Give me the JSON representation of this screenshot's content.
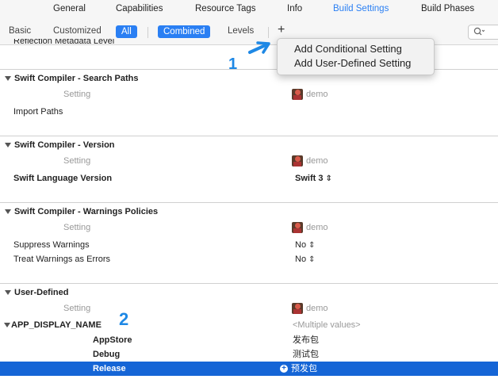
{
  "tabs": [
    "General",
    "Capabilities",
    "Resource Tags",
    "Info",
    "Build Settings",
    "Build Phases"
  ],
  "filters": {
    "basic": "Basic",
    "customized": "Customized",
    "all": "All",
    "combined": "Combined",
    "levels": "Levels",
    "add": "+"
  },
  "menu": {
    "item1": "Add Conditional Setting",
    "item2": "Add User-Defined Setting"
  },
  "cutoff_row": "Reflection Metadata Level",
  "sections": {
    "search_paths": {
      "title": "Swift Compiler - Search Paths",
      "setting_header": "Setting",
      "target": "demo",
      "rows": [
        {
          "name": "Import Paths",
          "value": ""
        }
      ]
    },
    "version": {
      "title": "Swift Compiler - Version",
      "setting_header": "Setting",
      "target": "demo",
      "rows": [
        {
          "name": "Swift Language Version",
          "value": "Swift 3"
        }
      ]
    },
    "warnings": {
      "title": "Swift Compiler - Warnings Policies",
      "setting_header": "Setting",
      "target": "demo",
      "rows": [
        {
          "name": "Suppress Warnings",
          "value": "No"
        },
        {
          "name": "Treat Warnings as Errors",
          "value": "No"
        }
      ]
    },
    "user_defined": {
      "title": "User-Defined",
      "setting_header": "Setting",
      "target": "demo",
      "key": "APP_DISPLAY_NAME",
      "key_value": "<Multiple values>",
      "configs": [
        {
          "name": "AppStore",
          "value": "发布包"
        },
        {
          "name": "Debug",
          "value": "测试包"
        },
        {
          "name": "Release",
          "value": "预发包"
        }
      ]
    }
  },
  "annotations": {
    "one": "1",
    "two": "2"
  },
  "colors": {
    "accent": "#2a7ff3",
    "selection": "#1565d6",
    "annotation": "#1e88e5"
  }
}
